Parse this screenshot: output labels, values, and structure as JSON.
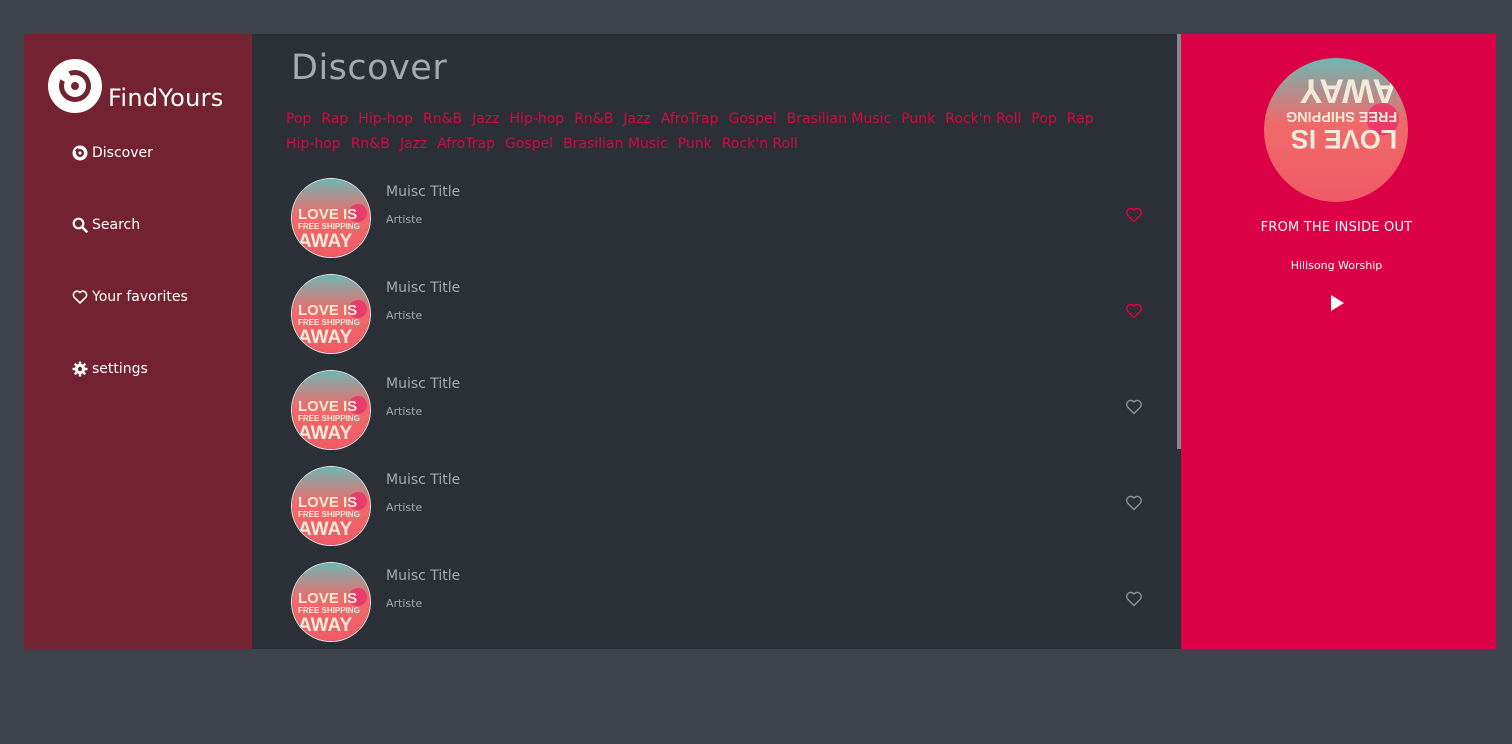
{
  "app": {
    "name": "FindYours"
  },
  "sidebar": {
    "items": [
      {
        "label": "Discover",
        "icon": "disc-icon"
      },
      {
        "label": "Search",
        "icon": "search-icon"
      },
      {
        "label": "Your favorites",
        "icon": "heart-icon"
      },
      {
        "label": "settings",
        "icon": "gear-icon"
      }
    ]
  },
  "main": {
    "title": "Discover",
    "genres": [
      "Pop",
      "Rap",
      "Hip-hop",
      "Rn&B",
      "Jazz",
      "Hip-hop",
      "Rn&B",
      "Jazz",
      "AfroTrap",
      "Gospel",
      "Brasilian Music",
      "Punk",
      "Rock'n Roll",
      "Pop",
      "Rap",
      "Hip-hop",
      "Rn&B",
      "Jazz",
      "AfroTrap",
      "Gospel",
      "Brasilian Music",
      "Punk",
      "Rock'n Roll"
    ],
    "tracks": [
      {
        "title": "Muisc Title",
        "artist": "Artiste",
        "favorited": true
      },
      {
        "title": "Muisc Title",
        "artist": "Artiste",
        "favorited": true
      },
      {
        "title": "Muisc Title",
        "artist": "Artiste",
        "favorited": false
      },
      {
        "title": "Muisc Title",
        "artist": "Artiste",
        "favorited": false
      },
      {
        "title": "Muisc Title",
        "artist": "Artiste",
        "favorited": false
      }
    ],
    "cover_text": [
      "LOVE IS",
      "FREE SHIPPING",
      "AWAY"
    ]
  },
  "player": {
    "title": "FROM THE INSIDE OUT",
    "artist": "Hillsong Worship",
    "play_icon": "play-icon"
  },
  "colors": {
    "accent": "#dc0146",
    "sidebar": "#722231",
    "main_bg": "#2b2f36",
    "page_bg": "#3d424b",
    "favorited": "#dc0146",
    "unfavorited": "#8a8c91"
  }
}
